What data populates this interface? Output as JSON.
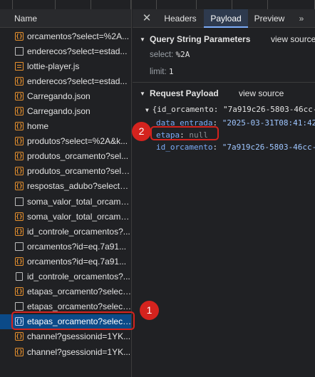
{
  "requests": {
    "header": "Name",
    "items": [
      {
        "label": "orcamentos?select=%2A...",
        "icon": "xhr"
      },
      {
        "label": "enderecos?select=estad...",
        "icon": "doc"
      },
      {
        "label": "lottie-player.js",
        "icon": "script"
      },
      {
        "label": "enderecos?select=estad...",
        "icon": "xhr"
      },
      {
        "label": "Carregando.json",
        "icon": "xhr"
      },
      {
        "label": "Carregando.json",
        "icon": "xhr"
      },
      {
        "label": "home",
        "icon": "xhr"
      },
      {
        "label": "produtos?select=%2A&k...",
        "icon": "xhr"
      },
      {
        "label": "produtos_orcamento?sel...",
        "icon": "xhr"
      },
      {
        "label": "produtos_orcamento?sele...",
        "icon": "xhr"
      },
      {
        "label": "respostas_adubo?select=...",
        "icon": "xhr"
      },
      {
        "label": "soma_valor_total_orcame...",
        "icon": "doc"
      },
      {
        "label": "soma_valor_total_orcame...",
        "icon": "xhr"
      },
      {
        "label": "id_controle_orcamentos?...",
        "icon": "xhr"
      },
      {
        "label": "orcamentos?id=eq.7a91...",
        "icon": "doc"
      },
      {
        "label": "orcamentos?id=eq.7a91...",
        "icon": "xhr"
      },
      {
        "label": "id_controle_orcamentos?...",
        "icon": "page"
      },
      {
        "label": "etapas_orcamento?select...",
        "icon": "xhr"
      },
      {
        "label": "etapas_orcamento?select...",
        "icon": "doc"
      },
      {
        "label": "etapas_orcamento?select...",
        "icon": "xhr",
        "selected": true
      },
      {
        "label": "channel?gsessionid=1YK...",
        "icon": "xhr"
      },
      {
        "label": "channel?gsessionid=1YK...",
        "icon": "xhr"
      }
    ]
  },
  "tabs": {
    "close": "✕",
    "items": [
      "Headers",
      "Payload",
      "Preview"
    ],
    "active": "Payload",
    "more": "»"
  },
  "query": {
    "title": "Query String Parameters",
    "view_source": "view source",
    "params": [
      {
        "key": "select:",
        "value": "%2A"
      },
      {
        "key": "limit:",
        "value": "1"
      }
    ]
  },
  "payload": {
    "title": "Request Payload",
    "view_source": "view source",
    "summary_prefix": "{",
    "summary_key": "id_orcamento",
    "summary_value": ": \"7a919c26-5803-46cc-...",
    "fields": [
      {
        "key": "data_entrada",
        "value": "\"2025-03-31T08:41:42..."
      },
      {
        "key": "etapa",
        "value": "null"
      },
      {
        "key": "id_orcamento",
        "value": "\"7a919c26-5803-46cc-..."
      }
    ]
  },
  "annotations": {
    "badge_1": "1",
    "badge_2": "2",
    "color": "#d4231e"
  },
  "colors": {
    "selected_row": "#0b4a88",
    "active_tab_underline": "#7cacf8",
    "icon_xhr": "#e8912d"
  }
}
